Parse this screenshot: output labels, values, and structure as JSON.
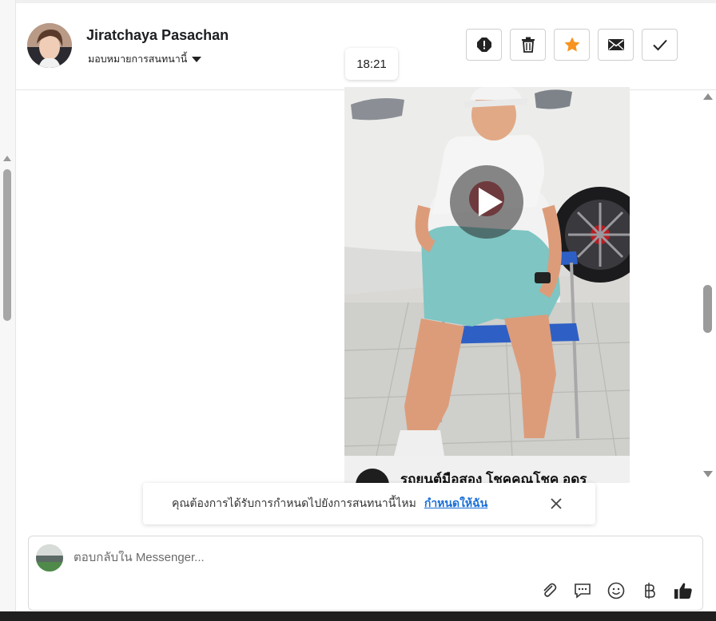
{
  "header": {
    "user_name": "Jiratchaya Pasachan",
    "assign_label": "มอบหมายการสนทนานี้",
    "actions": [
      {
        "name": "report-button",
        "icon": "alert-icon"
      },
      {
        "name": "delete-button",
        "icon": "trash-icon"
      },
      {
        "name": "star-button",
        "icon": "star-icon",
        "color": "#f7931e"
      },
      {
        "name": "mark-unread-button",
        "icon": "envelope-icon"
      },
      {
        "name": "done-button",
        "icon": "check-icon"
      }
    ]
  },
  "conversation": {
    "timestamp": "18:21",
    "link_preview_title": "รถยนต์มือสอง โชคคุณโชค อุดร"
  },
  "assignment_prompt": {
    "message": "คุณต้องการได้รับการกำหนดไปยังการสนทนานี้ไหม",
    "action_label": "กำหนดให้ฉัน"
  },
  "composer": {
    "placeholder": "ตอบกลับใน Messenger...",
    "tools": [
      "attach-icon",
      "saved-reply-icon",
      "emoji-icon",
      "baht-icon",
      "thumbs-up-icon"
    ]
  },
  "colors": {
    "accent_link": "#1a6fd8",
    "star": "#f7931e",
    "like": "#222222"
  }
}
